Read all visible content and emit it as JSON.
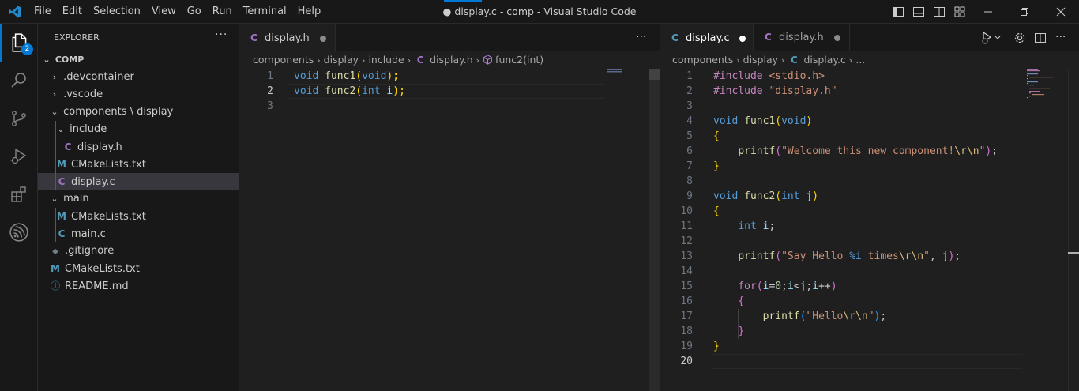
{
  "titlebar": {
    "menu": [
      "File",
      "Edit",
      "Selection",
      "View",
      "Go",
      "Run",
      "Terminal",
      "Help"
    ],
    "title": "● display.c - comp - Visual Studio Code"
  },
  "activitybar": {
    "explorer_badge": "2"
  },
  "sidebar": {
    "header": "EXPLORER",
    "more": "···",
    "root": "COMP",
    "items": [
      {
        "label": ".devcontainer"
      },
      {
        "label": ".vscode"
      },
      {
        "label": "components \\ display"
      },
      {
        "label": "include"
      },
      {
        "label": "display.h",
        "icon": "C"
      },
      {
        "label": "CMakeLists.txt",
        "icon": "M"
      },
      {
        "label": "display.c",
        "icon": "C"
      },
      {
        "label": "main"
      },
      {
        "label": "CMakeLists.txt",
        "icon": "M"
      },
      {
        "label": "main.c",
        "icon": "C"
      },
      {
        "label": ".gitignore",
        "icon": "◆"
      },
      {
        "label": "CMakeLists.txt",
        "icon": "M"
      },
      {
        "label": "README.md",
        "icon": "ⓘ"
      }
    ]
  },
  "left_editor": {
    "tab": {
      "icon": "C",
      "label": "display.h"
    },
    "more": "···",
    "breadcrumbs": [
      "components",
      "display",
      "include",
      "display.h",
      "func2(int)"
    ],
    "breadcrumb_file_icon": "C",
    "line_numbers": [
      "1",
      "2",
      "3"
    ],
    "lines": [
      [
        {
          "t": "void",
          "c": "kw"
        },
        {
          "t": " "
        },
        {
          "t": "func1",
          "c": "fn"
        },
        {
          "t": "(",
          "c": "br1"
        },
        {
          "t": "void",
          "c": "kw"
        },
        {
          "t": ");",
          "c": "br1"
        }
      ],
      [
        {
          "t": "void",
          "c": "kw"
        },
        {
          "t": " "
        },
        {
          "t": "func2",
          "c": "fn"
        },
        {
          "t": "(",
          "c": "br1"
        },
        {
          "t": "int",
          "c": "kw"
        },
        {
          "t": " "
        },
        {
          "t": "i",
          "c": "var"
        },
        {
          "t": ");",
          "c": "br1"
        }
      ],
      []
    ]
  },
  "right_editor": {
    "tabs": [
      {
        "icon": "C",
        "label": "display.c"
      },
      {
        "icon": "C",
        "label": "display.h"
      }
    ],
    "breadcrumbs": [
      "components",
      "display",
      "display.c",
      "..."
    ],
    "breadcrumb_file_icon": "C",
    "line_numbers": [
      "1",
      "2",
      "3",
      "4",
      "5",
      "6",
      "7",
      "8",
      "9",
      "10",
      "11",
      "12",
      "13",
      "14",
      "15",
      "16",
      "17",
      "18",
      "19",
      "20"
    ],
    "lines": [
      [
        {
          "t": "#include",
          "c": "pp"
        },
        {
          "t": " "
        },
        {
          "t": "<stdio.h>",
          "c": "str"
        }
      ],
      [
        {
          "t": "#include",
          "c": "pp"
        },
        {
          "t": " "
        },
        {
          "t": "\"display.h\"",
          "c": "str"
        }
      ],
      [],
      [
        {
          "t": "void",
          "c": "kw"
        },
        {
          "t": " "
        },
        {
          "t": "func1",
          "c": "fn"
        },
        {
          "t": "(",
          "c": "br1"
        },
        {
          "t": "void",
          "c": "kw"
        },
        {
          "t": ")",
          "c": "br1"
        }
      ],
      [
        {
          "t": "{",
          "c": "br1"
        }
      ],
      [
        {
          "t": "    "
        },
        {
          "t": "printf",
          "c": "fn"
        },
        {
          "t": "(",
          "c": "br2"
        },
        {
          "t": "\"Welcome this new component!",
          "c": "str"
        },
        {
          "t": "\\r\\n",
          "c": "esc"
        },
        {
          "t": "\"",
          "c": "str"
        },
        {
          "t": ")",
          "c": "br2"
        },
        {
          "t": ";"
        }
      ],
      [
        {
          "t": "}",
          "c": "br1"
        }
      ],
      [],
      [
        {
          "t": "void",
          "c": "kw"
        },
        {
          "t": " "
        },
        {
          "t": "func2",
          "c": "fn"
        },
        {
          "t": "(",
          "c": "br1"
        },
        {
          "t": "int",
          "c": "kw"
        },
        {
          "t": " "
        },
        {
          "t": "j",
          "c": "var"
        },
        {
          "t": ")",
          "c": "br1"
        }
      ],
      [
        {
          "t": "{",
          "c": "br1"
        }
      ],
      [
        {
          "t": "    "
        },
        {
          "t": "int",
          "c": "kw"
        },
        {
          "t": " "
        },
        {
          "t": "i",
          "c": "var"
        },
        {
          "t": ";"
        }
      ],
      [],
      [
        {
          "t": "    "
        },
        {
          "t": "printf",
          "c": "fn"
        },
        {
          "t": "(",
          "c": "br2"
        },
        {
          "t": "\"Say Hello ",
          "c": "str"
        },
        {
          "t": "%i",
          "c": "kw"
        },
        {
          "t": " times",
          "c": "str"
        },
        {
          "t": "\\r\\n",
          "c": "esc"
        },
        {
          "t": "\"",
          "c": "str"
        },
        {
          "t": ", "
        },
        {
          "t": "j",
          "c": "var"
        },
        {
          "t": ")",
          "c": "br2"
        },
        {
          "t": ";"
        }
      ],
      [],
      [
        {
          "t": "    "
        },
        {
          "t": "for",
          "c": "pp"
        },
        {
          "t": "(",
          "c": "br2"
        },
        {
          "t": "i",
          "c": "var"
        },
        {
          "t": "="
        },
        {
          "t": "0",
          "c": "num"
        },
        {
          "t": ";"
        },
        {
          "t": "i",
          "c": "var"
        },
        {
          "t": "<"
        },
        {
          "t": "j",
          "c": "var"
        },
        {
          "t": ";"
        },
        {
          "t": "i",
          "c": "var"
        },
        {
          "t": "++"
        },
        {
          "t": ")",
          "c": "br2"
        }
      ],
      [
        {
          "t": "    "
        },
        {
          "t": "{",
          "c": "br2"
        }
      ],
      [
        {
          "t": "        "
        },
        {
          "t": "printf",
          "c": "fn"
        },
        {
          "t": "(",
          "c": "br3"
        },
        {
          "t": "\"Hello",
          "c": "str"
        },
        {
          "t": "\\r\\n",
          "c": "esc"
        },
        {
          "t": "\"",
          "c": "str"
        },
        {
          "t": ")",
          "c": "br3"
        },
        {
          "t": ";"
        }
      ],
      [
        {
          "t": "    "
        },
        {
          "t": "}",
          "c": "br2"
        }
      ],
      [
        {
          "t": "}",
          "c": "br1"
        }
      ],
      []
    ]
  },
  "colors": {
    "accent": "#0078d4",
    "background": "#1f1f1f",
    "sidebar": "#181818",
    "selection": "#37373d"
  }
}
